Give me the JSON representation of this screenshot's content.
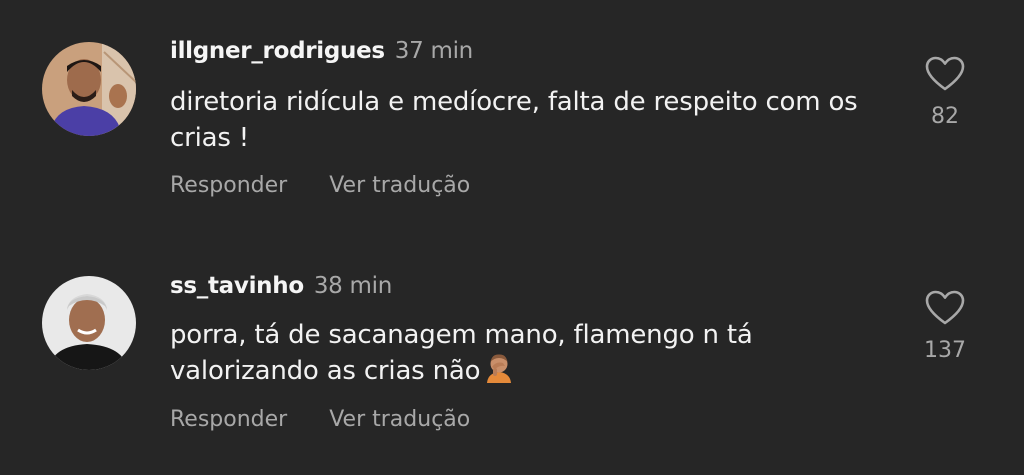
{
  "comments": [
    {
      "username": "illgner_rodrigues",
      "time": "37 min",
      "text": "diretoria ridícula e medíocre, falta de respeito com os crias !",
      "reply_label": "Responder",
      "translate_label": "Ver tradução",
      "likes": "82",
      "avatar_bg": "#c9a07d"
    },
    {
      "username": "ss_tavinho",
      "time": "38 min",
      "text": "porra, tá de sacanagem mano, flamengo n tá valorizando as crias não",
      "emoji": "person-facepalming",
      "reply_label": "Responder",
      "translate_label": "Ver tradução",
      "likes": "137",
      "avatar_bg": "#e9e9e9"
    }
  ],
  "colors": {
    "background": "#262626",
    "primary_text": "#f2f2f2",
    "secondary_text": "#a8a8a8"
  }
}
